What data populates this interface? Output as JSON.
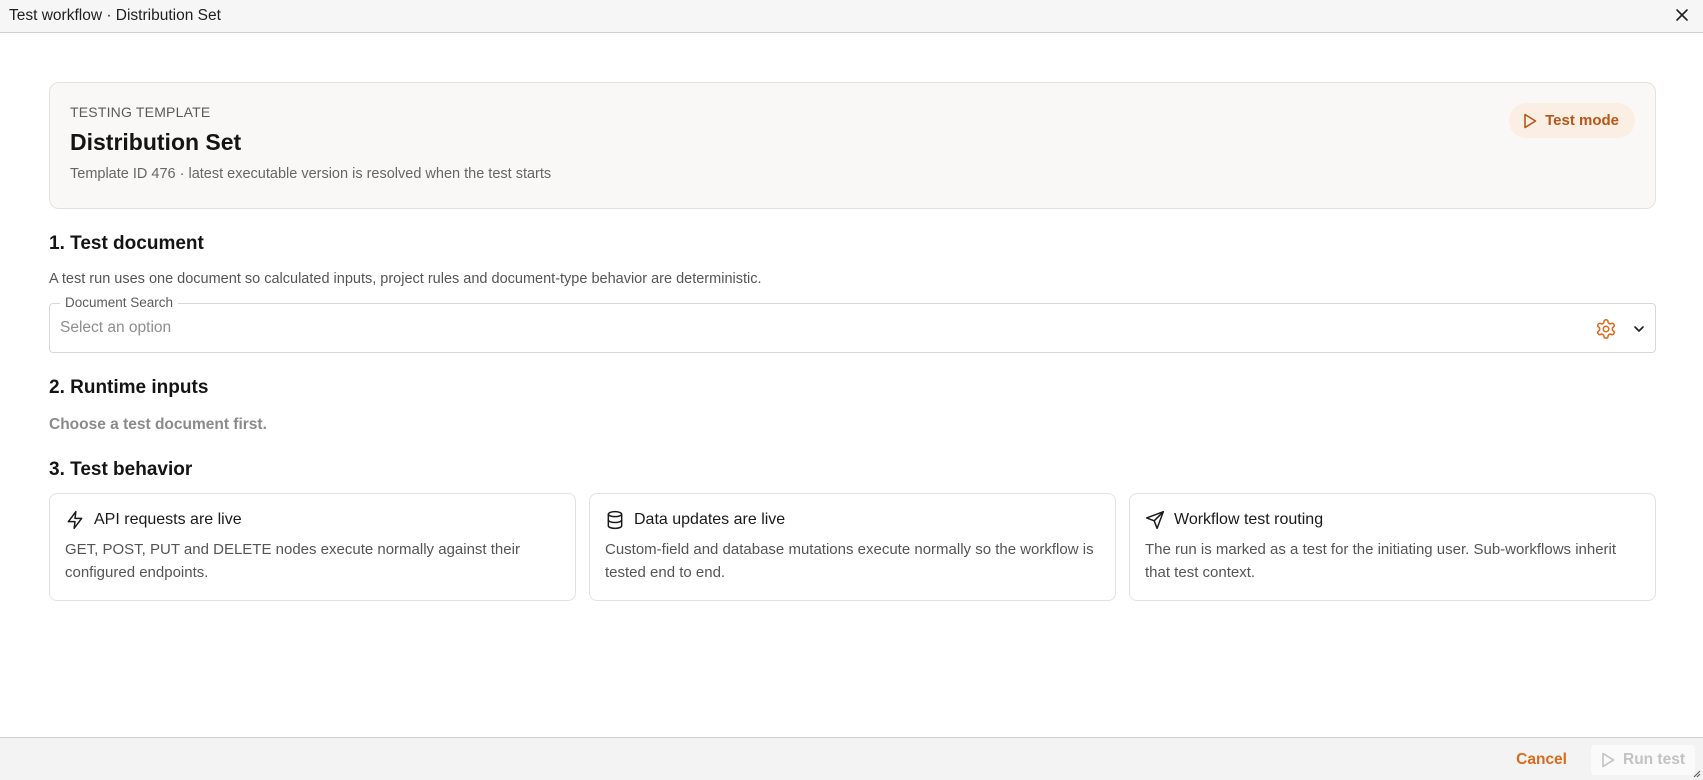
{
  "window": {
    "title": "Test workflow · Distribution Set"
  },
  "template": {
    "eyebrow": "TESTING TEMPLATE",
    "name": "Distribution Set",
    "subtitle": "Template ID 476 · latest executable version is resolved when the test starts",
    "badge": "Test mode"
  },
  "section1": {
    "title": "1. Test document",
    "description": "A test run uses one document so calculated inputs, project rules and document-type behavior are deterministic.",
    "field_label": "Document Search",
    "placeholder": "Select an option"
  },
  "section2": {
    "title": "2. Runtime inputs",
    "description": "Choose a test document first."
  },
  "section3": {
    "title": "3. Test behavior",
    "cards": [
      {
        "icon": "lightning-icon",
        "title": "API requests are live",
        "text": "GET, POST, PUT and DELETE nodes execute normally against their configured endpoints."
      },
      {
        "icon": "database-icon",
        "title": "Data updates are live",
        "text": "Custom-field and database mutations execute normally so the workflow is tested end to end."
      },
      {
        "icon": "send-icon",
        "title": "Workflow test routing",
        "text": "The run is marked as a test for the initiating user. Sub-workflows inherit that test context."
      }
    ]
  },
  "footer": {
    "cancel": "Cancel",
    "run": "Run test"
  },
  "colors": {
    "accent": "#dd6a1c",
    "badge_bg": "#fbeee2",
    "disabled": "#c2c2c2"
  }
}
